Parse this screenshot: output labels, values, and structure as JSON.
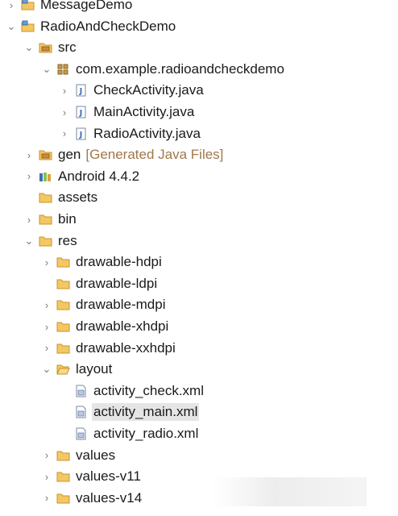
{
  "tree": [
    {
      "name": "tree-item-messagedemo",
      "depth": 0,
      "chevron": "collapsed",
      "icon": "project-folder-icon",
      "label": "MessageDemo"
    },
    {
      "name": "tree-item-radioandcheckdemo",
      "depth": 0,
      "chevron": "expanded",
      "icon": "project-folder-icon",
      "label": "RadioAndCheckDemo"
    },
    {
      "name": "tree-item-src",
      "depth": 1,
      "chevron": "expanded",
      "icon": "source-folder-icon",
      "label": "src"
    },
    {
      "name": "tree-item-package",
      "depth": 2,
      "chevron": "expanded",
      "icon": "package-icon",
      "label": "com.example.radioandcheckdemo"
    },
    {
      "name": "tree-item-checkactivity",
      "depth": 3,
      "chevron": "collapsed",
      "icon": "java-file-icon",
      "label": "CheckActivity.java"
    },
    {
      "name": "tree-item-mainactivity",
      "depth": 3,
      "chevron": "collapsed",
      "icon": "java-file-icon",
      "label": "MainActivity.java"
    },
    {
      "name": "tree-item-radioactivity",
      "depth": 3,
      "chevron": "collapsed",
      "icon": "java-file-icon",
      "label": "RadioActivity.java"
    },
    {
      "name": "tree-item-gen",
      "depth": 1,
      "chevron": "collapsed",
      "icon": "source-folder-icon",
      "label": "gen",
      "suffix": "[Generated Java Files]"
    },
    {
      "name": "tree-item-android",
      "depth": 1,
      "chevron": "collapsed",
      "icon": "library-icon",
      "label": "Android 4.4.2"
    },
    {
      "name": "tree-item-assets",
      "depth": 1,
      "chevron": "none",
      "icon": "folder-icon",
      "label": "assets"
    },
    {
      "name": "tree-item-bin",
      "depth": 1,
      "chevron": "collapsed",
      "icon": "folder-icon",
      "label": "bin"
    },
    {
      "name": "tree-item-res",
      "depth": 1,
      "chevron": "expanded",
      "icon": "folder-icon",
      "label": "res"
    },
    {
      "name": "tree-item-drawable-hdpi",
      "depth": 2,
      "chevron": "collapsed",
      "icon": "folder-icon",
      "label": "drawable-hdpi"
    },
    {
      "name": "tree-item-drawable-ldpi",
      "depth": 2,
      "chevron": "none",
      "icon": "folder-icon",
      "label": "drawable-ldpi"
    },
    {
      "name": "tree-item-drawable-mdpi",
      "depth": 2,
      "chevron": "collapsed",
      "icon": "folder-icon",
      "label": "drawable-mdpi"
    },
    {
      "name": "tree-item-drawable-xhdpi",
      "depth": 2,
      "chevron": "collapsed",
      "icon": "folder-icon",
      "label": "drawable-xhdpi"
    },
    {
      "name": "tree-item-drawable-xxhdpi",
      "depth": 2,
      "chevron": "collapsed",
      "icon": "folder-icon",
      "label": "drawable-xxhdpi"
    },
    {
      "name": "tree-item-layout",
      "depth": 2,
      "chevron": "expanded",
      "icon": "open-folder-icon",
      "label": "layout"
    },
    {
      "name": "tree-item-activity-check",
      "depth": 3,
      "chevron": "none",
      "icon": "xml-file-icon",
      "label": "activity_check.xml"
    },
    {
      "name": "tree-item-activity-main",
      "depth": 3,
      "chevron": "none",
      "icon": "xml-file-icon",
      "label": "activity_main.xml",
      "selected": true
    },
    {
      "name": "tree-item-activity-radio",
      "depth": 3,
      "chevron": "none",
      "icon": "xml-file-icon",
      "label": "activity_radio.xml"
    },
    {
      "name": "tree-item-values",
      "depth": 2,
      "chevron": "collapsed",
      "icon": "folder-icon",
      "label": "values"
    },
    {
      "name": "tree-item-values-v11",
      "depth": 2,
      "chevron": "collapsed",
      "icon": "folder-icon",
      "label": "values-v11"
    },
    {
      "name": "tree-item-values-v14",
      "depth": 2,
      "chevron": "collapsed",
      "icon": "folder-icon",
      "label": "values-v14"
    }
  ],
  "colors": {
    "folder": "#e8b84a",
    "java": "#3a6fb5",
    "xml": "#6f7fa0",
    "selected": "#e5e5e5",
    "suffix": "#a07848",
    "chevron": "#7a7a7a"
  }
}
